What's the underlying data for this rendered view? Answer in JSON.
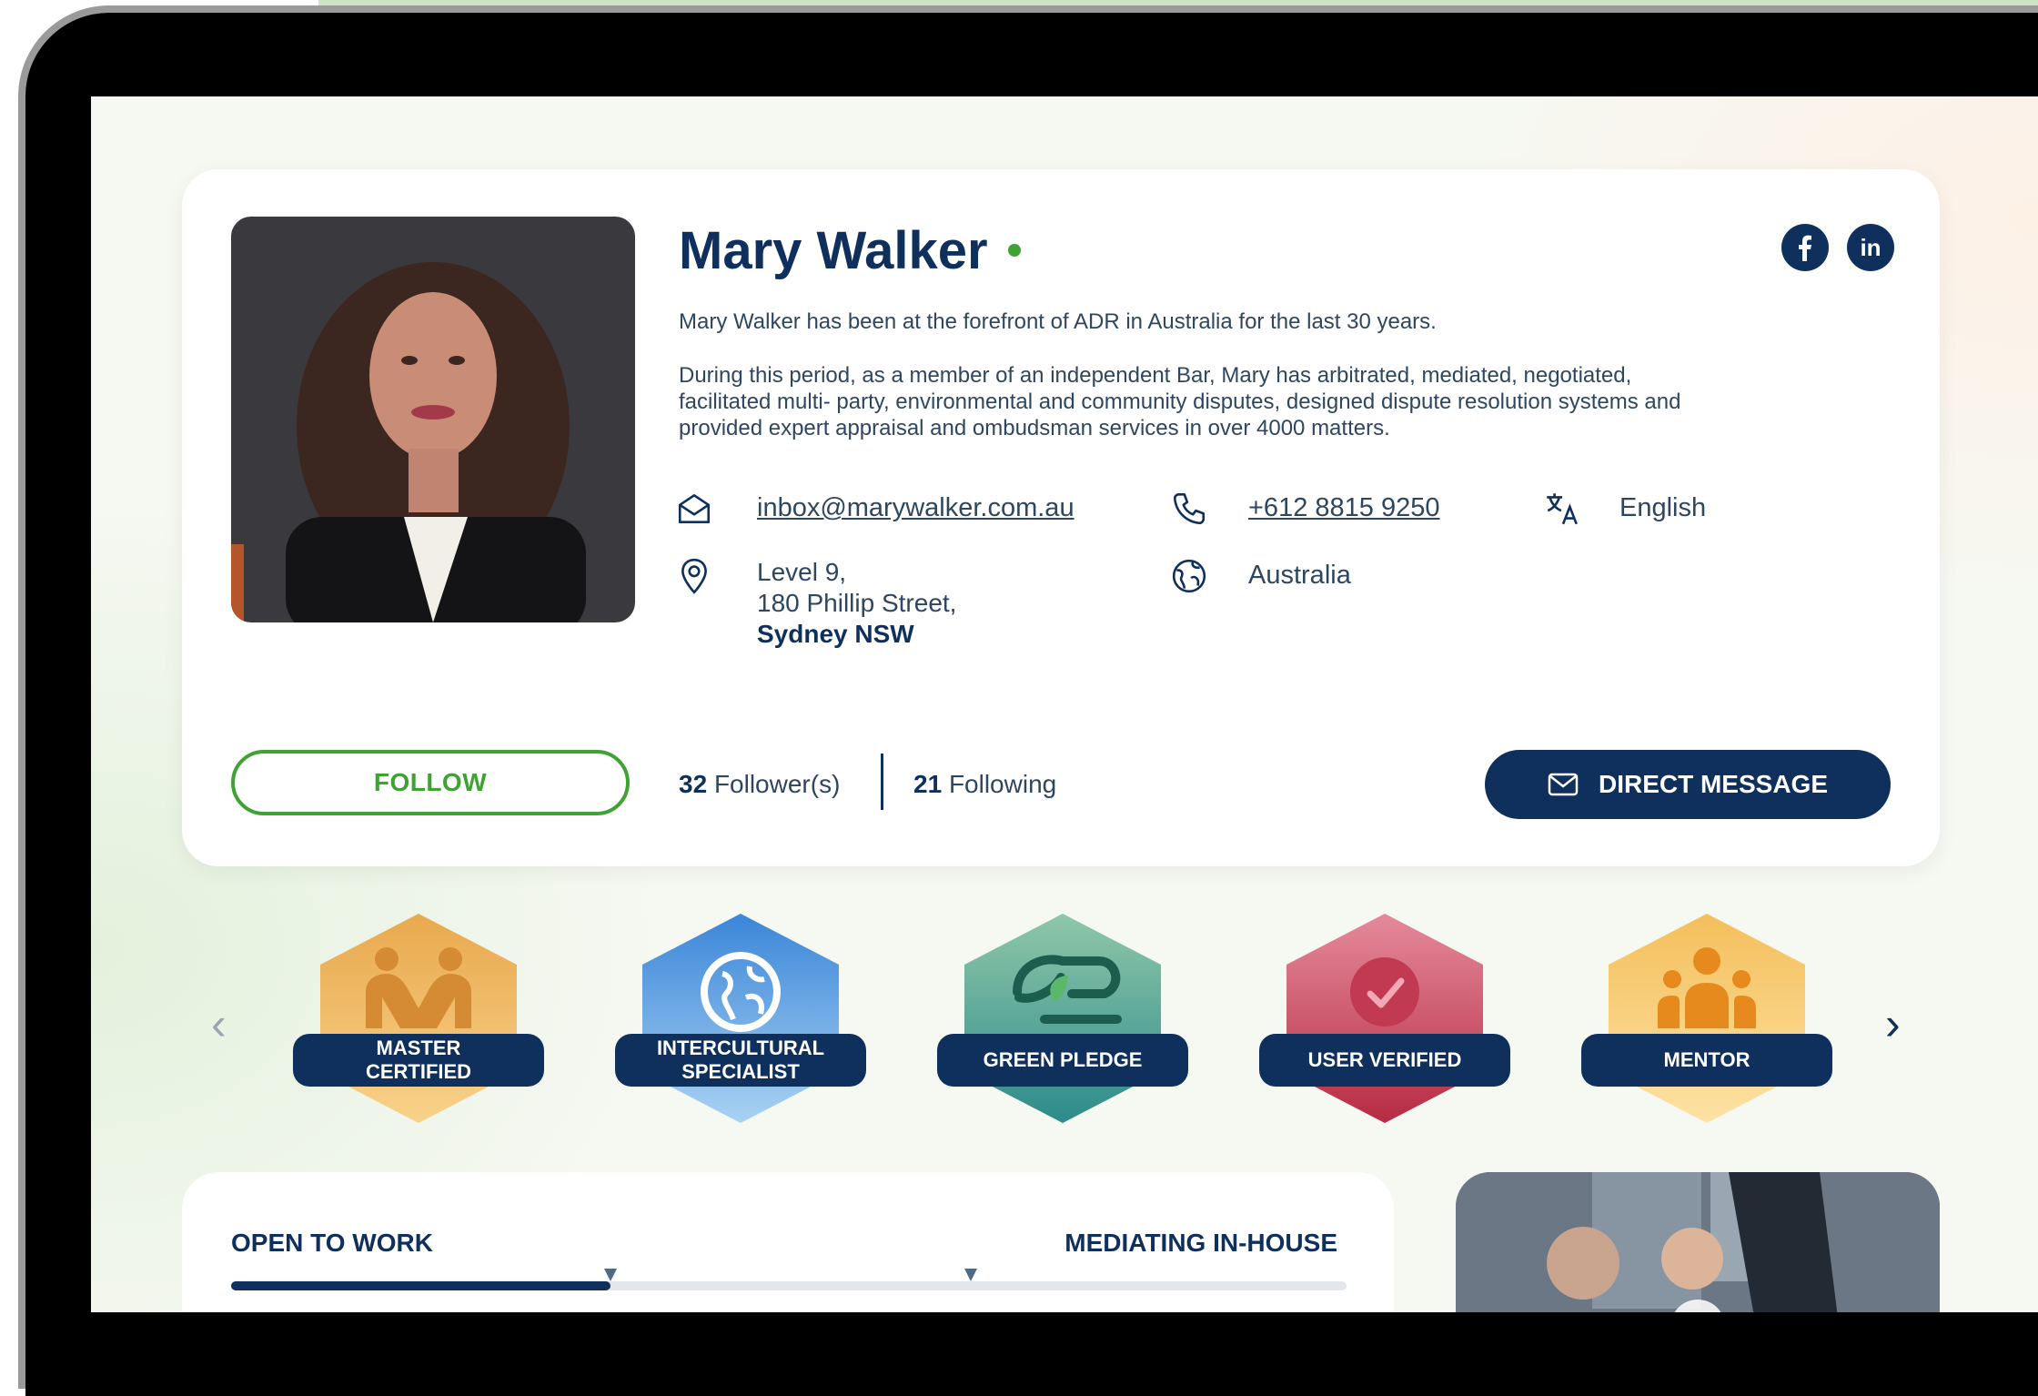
{
  "profile": {
    "name": "Mary Walker",
    "bio_intro": "Mary Walker has been at the forefront of ADR in Australia for the last 30 years.",
    "bio_detail": "During this period, as a member of an independent Bar, Mary has arbitrated, mediated, negotiated, facilitated multi- party, environmental and community disputes, designed dispute resolution systems and provided expert appraisal and ombudsman services in over 4000 matters.",
    "online": true
  },
  "social": {
    "facebook_icon": "facebook-icon",
    "linkedin_icon": "linkedin-icon",
    "linkedin_text": "in",
    "facebook_text": "f"
  },
  "contact": {
    "email": "inbox@marywalker.com.au",
    "phone": "+612 8815 9250",
    "language": "English",
    "address_line1": "Level 9,",
    "address_line2": "180 Phillip Street,",
    "address_line3": "Sydney NSW",
    "country": "Australia"
  },
  "actions": {
    "follow_label": "FOLLOW",
    "followers_count": "32",
    "followers_label": "Follower(s)",
    "following_count": "21",
    "following_label": "Following",
    "dm_label": "DIRECT MESSAGE"
  },
  "badges": [
    {
      "line1": "MASTER",
      "line2": "CERTIFIED",
      "color": "#f0b357"
    },
    {
      "line1": "INTERCULTURAL",
      "line2": "SPECIALIST",
      "color": "#4a90d9"
    },
    {
      "line1": "GREEN PLEDGE",
      "line2": "",
      "color": "#5fa58a"
    },
    {
      "line1": "USER VERIFIED",
      "line2": "",
      "color": "#d2566a"
    },
    {
      "line1": "MENTOR",
      "line2": "",
      "color": "#f5c35a"
    }
  ],
  "carousel": {
    "prev": "‹",
    "next": "›"
  },
  "work_status": {
    "left_label": "OPEN TO WORK",
    "right_label": "MEDIATING IN-HOUSE",
    "progress": 0.34
  },
  "colors": {
    "navy": "#0f2f5c",
    "green": "#3fa334"
  }
}
